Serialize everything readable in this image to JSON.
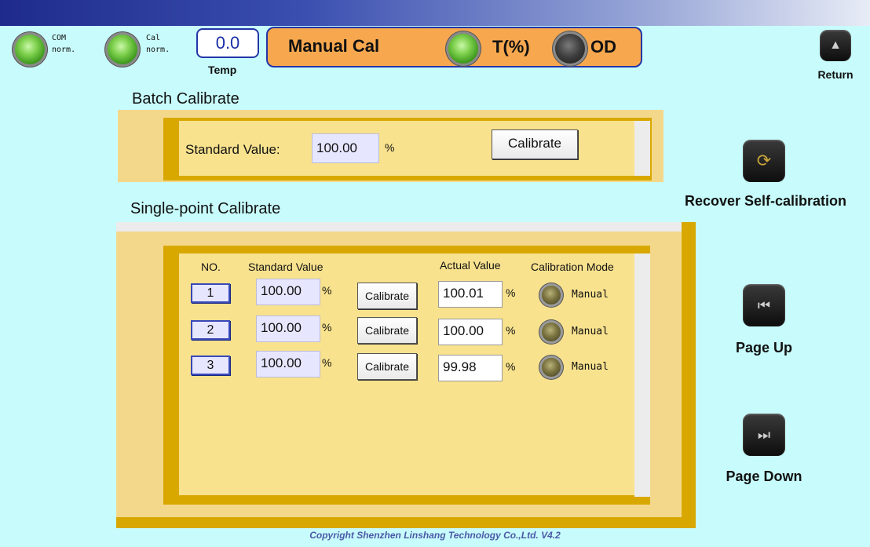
{
  "status": {
    "com_label": "COM",
    "com_state": "norm.",
    "cal_label": "Cal",
    "cal_state": "norm."
  },
  "temp": {
    "value": "0.0",
    "label": "Temp"
  },
  "mode": {
    "title": "Manual Cal",
    "option1": "T(%)",
    "option2": "OD",
    "selected": "T(%)"
  },
  "nav": {
    "return_label": "Return",
    "recover_label": "Recover Self-calibration",
    "page_up_label": "Page Up",
    "page_down_label": "Page Down"
  },
  "batch": {
    "title": "Batch Calibrate",
    "standard_label": "Standard Value:",
    "standard_value": "100.00",
    "unit": "%",
    "button": "Calibrate"
  },
  "single": {
    "title": "Single-point Calibrate",
    "headers": {
      "no": "NO.",
      "standard": "Standard Value",
      "actual": "Actual Value",
      "mode": "Calibration Mode"
    },
    "unit": "%",
    "button": "Calibrate",
    "rows": [
      {
        "no": "1",
        "standard": "100.00",
        "actual": "100.01",
        "mode": "Manual"
      },
      {
        "no": "2",
        "standard": "100.00",
        "actual": "100.00",
        "mode": "Manual"
      },
      {
        "no": "3",
        "standard": "100.00",
        "actual": "99.98",
        "mode": "Manual"
      }
    ]
  },
  "copyright": "Copyright Shenzhen Linshang Technology Co.,Ltd. V4.2",
  "colors": {
    "background": "#c8fbfb",
    "mode_panel": "#f7a84f",
    "frame": "#f8e28e",
    "accent": "#2436a8"
  }
}
